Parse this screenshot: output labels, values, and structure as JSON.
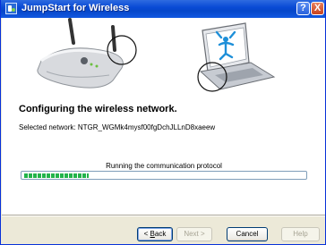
{
  "window": {
    "title": "JumpStart for Wireless",
    "title_icon": "jumpstart-app-icon",
    "controls": {
      "help": "?",
      "close": "X"
    }
  },
  "illustration": {
    "left_device": "router-icon",
    "right_device": "laptop-icon"
  },
  "content": {
    "heading": "Configuring the wireless network.",
    "network_label": "Selected network:",
    "network_name": "NTGR_WGMk4mysf00fgDchJLLnD8xaeew",
    "status_text": "Running the communication protocol",
    "progress_fraction": 0.23
  },
  "buttons": {
    "back_mnemonic": "B",
    "back_rest": "ack",
    "back_prefix": "<",
    "next": "Next >",
    "cancel": "Cancel",
    "help": "Help"
  },
  "colors": {
    "titlebar": "#0a4bd6",
    "progress": "#22b34a",
    "face": "#ece9d8"
  }
}
